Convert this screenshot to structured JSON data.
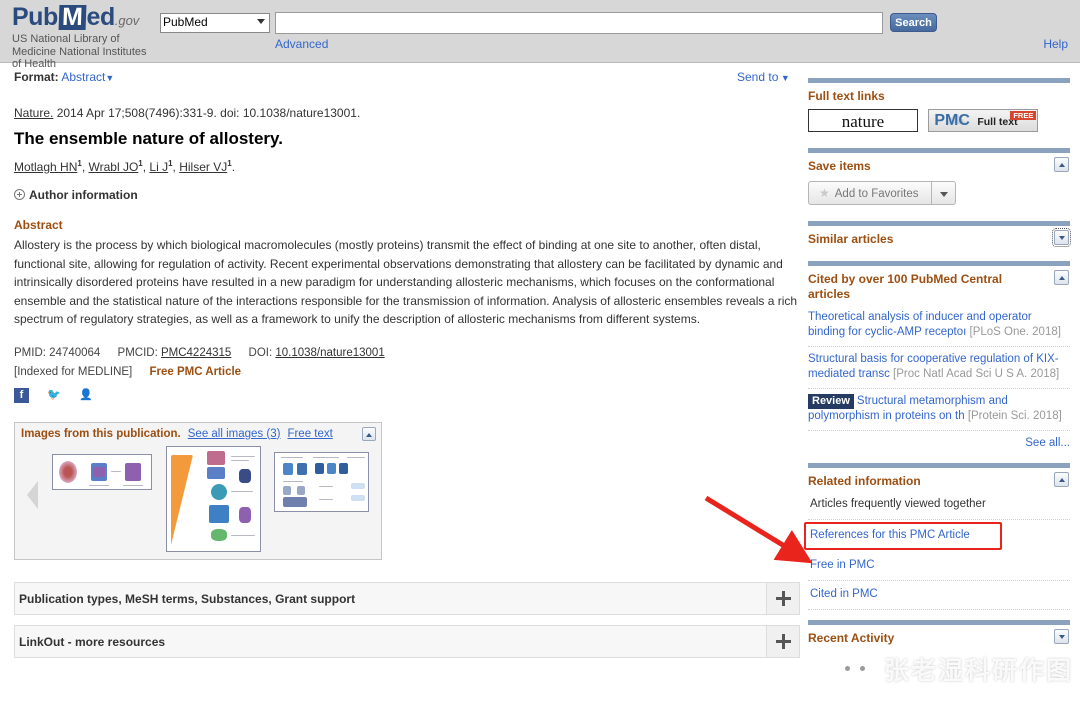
{
  "header": {
    "logo_pub": "Pub",
    "logo_med": "M",
    "logo_ed": "ed",
    "logo_gov": ".gov",
    "tagline": "US National Library of\nMedicine National Institutes\nof Health",
    "database": "PubMed",
    "search_value": "",
    "search_placeholder": "",
    "search_button": "Search",
    "advanced_link": "Advanced",
    "help_link": "Help"
  },
  "toolbar": {
    "format_label": "Format:",
    "format_value": "Abstract",
    "send_to": "Send to"
  },
  "article": {
    "journal": "Nature.",
    "citation": " 2014 Apr 17;508(7496):331-9. doi: 10.1038/nature13001.",
    "title": "The ensemble nature of allostery.",
    "authors": [
      {
        "name": "Motlagh HN",
        "sup": "1"
      },
      {
        "name": "Wrabl JO",
        "sup": "1"
      },
      {
        "name": "Li J",
        "sup": "1"
      },
      {
        "name": "Hilser VJ",
        "sup": "1"
      }
    ],
    "author_information": "Author information",
    "abstract_heading": "Abstract",
    "abstract": "Allostery is the process by which biological macromolecules (mostly proteins) transmit the effect of binding at one site to another, often distal, functional site, allowing for regulation of activity. Recent experimental observations demonstrating that allostery can be facilitated by dynamic and intrinsically disordered proteins have resulted in a new paradigm for understanding allosteric mechanisms, which focuses on the conformational ensemble and the statistical nature of the interactions responsible for the transmission of information. Analysis of allosteric ensembles reveals a rich spectrum of regulatory strategies, as well as a framework to unify the description of allosteric mechanisms from different systems.",
    "pmid_label": "PMID:",
    "pmid": "24740064",
    "pmcid_label": "PMCID:",
    "pmcid": "PMC4224315",
    "doi_label": "DOI:",
    "doi": "10.1038/nature13001",
    "indexed": "[Indexed for MEDLINE]",
    "free_article": "Free PMC Article"
  },
  "social": [
    {
      "name": "facebook-icon",
      "glyph": "f"
    },
    {
      "name": "twitter-icon",
      "glyph": "ᴠ"
    },
    {
      "name": "google-plus-icon",
      "glyph": "g+"
    }
  ],
  "images_panel": {
    "title": "Images from this publication.",
    "see_all": "See all images (3)",
    "free_text": "Free text"
  },
  "footer_sections": [
    {
      "label": "Publication types, MeSH terms, Substances, Grant support"
    },
    {
      "label": "LinkOut - more resources"
    }
  ],
  "sidebar": {
    "full_text_links": {
      "title": "Full text links",
      "nature_label": "nature",
      "pmc_label": "PMC",
      "pmc_full_text": "Full text",
      "pmc_free": "FREE"
    },
    "save_items": {
      "title": "Save items",
      "add_to_favorites": "Add to Favorites"
    },
    "similar_articles": {
      "title": "Similar articles"
    },
    "cited_by": {
      "title": "Cited by over 100 PubMed Central articles",
      "items": [
        {
          "text": "Theoretical analysis of inducer and operator binding for cyclic-AMP receptoı",
          "source": "[PLoS One. 2018]",
          "badge": ""
        },
        {
          "text": "Structural basis for cooperative regulation of KIX-mediated transc",
          "source": "[Proc Natl Acad Sci U S A. 2018]",
          "badge": ""
        },
        {
          "text": "Structural metamorphism and polymorphism in proteins on th",
          "source": "[Protein Sci. 2018]",
          "badge": "Review"
        }
      ],
      "see_all": "See all..."
    },
    "related_information": {
      "title": "Related information",
      "items": [
        {
          "label": "Articles frequently viewed together",
          "highlighted": false
        },
        {
          "label": "References for this PMC Article",
          "highlighted": true
        },
        {
          "label": "Free in PMC",
          "highlighted": false
        },
        {
          "label": "Cited in PMC",
          "highlighted": false
        }
      ]
    },
    "recent_activity": {
      "title": "Recent Activity"
    }
  },
  "annotation": {
    "arrow_color": "#e8241c",
    "highlight_color": "#e8241c"
  },
  "watermark": {
    "text": "张老湿科研作图"
  },
  "colors": {
    "link": "#3366cc",
    "heading_orange": "#9d4f12",
    "rule_blue": "#8ba2bf",
    "header_bg": "#d7d7d7"
  }
}
